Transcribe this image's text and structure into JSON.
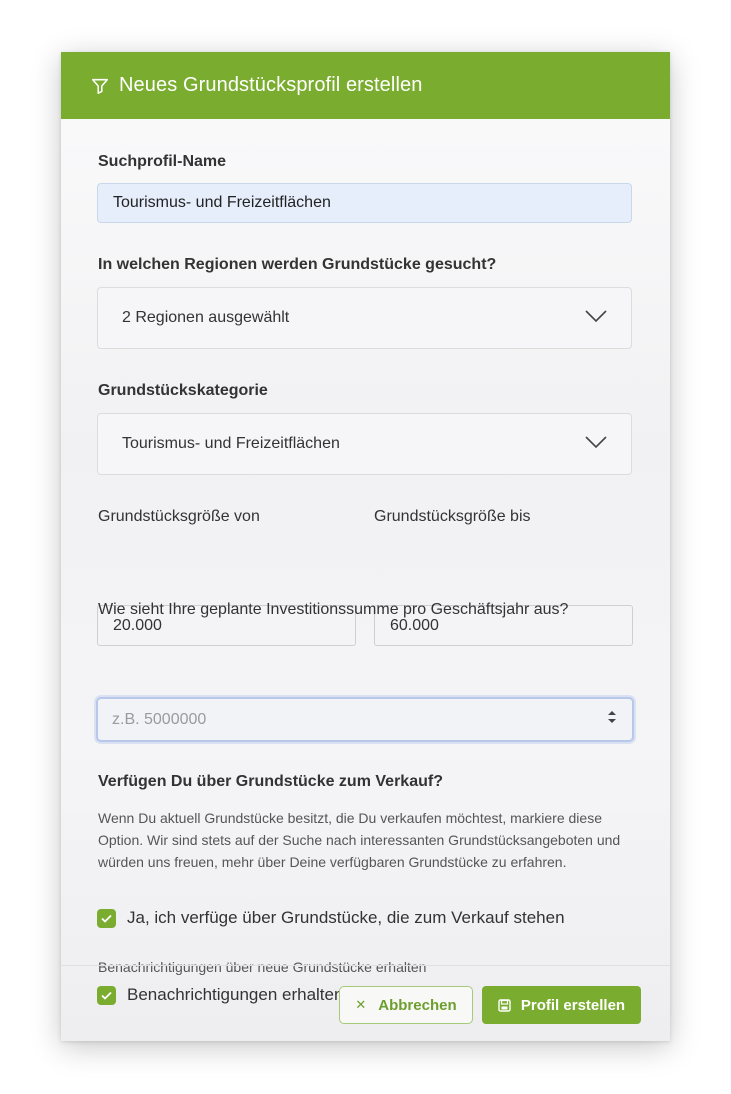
{
  "header": {
    "title": "Neues Grundstücksprofil erstellen",
    "icon": "filter-icon"
  },
  "form": {
    "profile_name": {
      "label": "Suchprofil-Name",
      "value": "Tourismus- und Freizeitflächen"
    },
    "regions": {
      "label": "In welchen Regionen werden Grundstücke gesucht?",
      "selected": "2 Regionen ausgewählt"
    },
    "category": {
      "label": "Grundstückskategorie",
      "selected": "Tourismus- und Freizeitflächen"
    },
    "size_from": {
      "label": "Grundstücksgröße von",
      "value": "20.000"
    },
    "size_to": {
      "label": "Grundstücksgröße bis",
      "value": "60.000"
    },
    "investment": {
      "label": "Wie sieht Ihre geplante Investitionssumme pro Geschäftsjahr aus?",
      "placeholder": "z.B. 5000000"
    },
    "sell": {
      "heading": "Verfügen Du über Grundstücke zum Verkauf?",
      "description": "Wenn Du aktuell Grundstücke besitzt, die Du verkaufen möchtest, markiere diese Option. Wir sind stets auf der Suche nach interessanten Grundstücksangeboten und würden uns freuen, mehr über Deine verfügbaren Grundstücke zu erfahren.",
      "checkbox_label": "Ja, ich verfüge über Grundstücke, die zum Verkauf stehen",
      "checked": true
    },
    "notifications": {
      "label": "Benachrichtigungen über neue Grundstücke erhalten",
      "checkbox_label": "Benachrichtigungen erhalten",
      "checked": true
    }
  },
  "footer": {
    "cancel_label": "Abbrechen",
    "submit_label": "Profil erstellen"
  },
  "colors": {
    "primary": "#7aad2f",
    "input_active_bg": "#e6eefb"
  }
}
